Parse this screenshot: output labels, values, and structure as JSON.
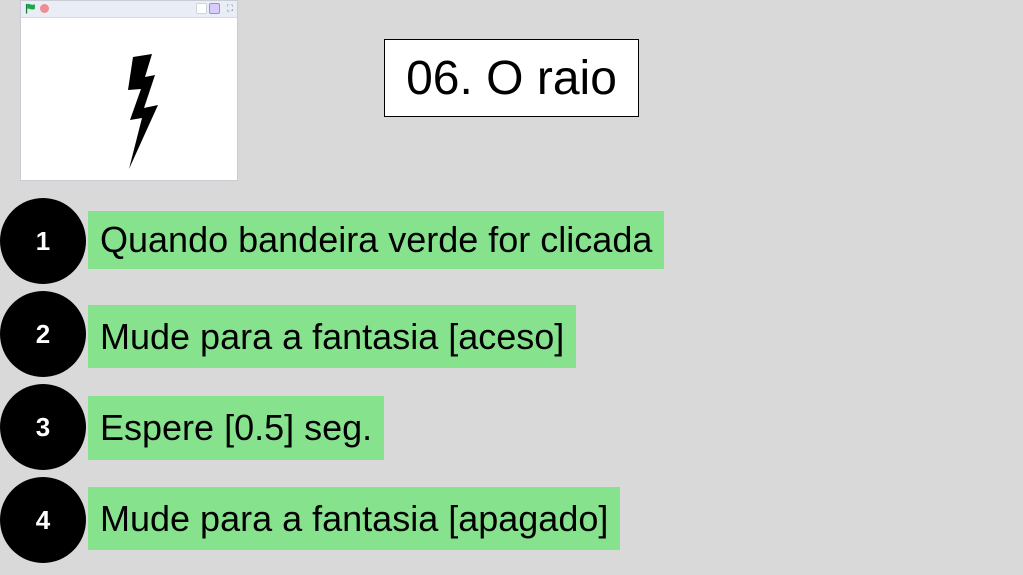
{
  "stage": {
    "toolbar": {
      "green_flag_icon": "green-flag-icon",
      "stop_icon": "stop-icon",
      "small_stage_icon": "small-stage-icon",
      "large_stage_icon": "large-stage-icon",
      "fullscreen_icon": "fullscreen-icon",
      "fullscreen_glyph": "⛶"
    },
    "sprite_icon": "lightning-bolt-icon"
  },
  "title": "06. O raio",
  "steps": [
    {
      "number": "1",
      "text": "Quando bandeira verde for clicada"
    },
    {
      "number": "2",
      "text": "Mude para a fantasia [aceso]"
    },
    {
      "number": "3",
      "text": "Espere [0.5] seg."
    },
    {
      "number": "4",
      "text": "Mude para a fantasia [apagado]"
    }
  ],
  "colors": {
    "background": "#d9d9d9",
    "step_highlight": "#87e28e",
    "step_circle": "#000000",
    "flag_green": "#1aa74b",
    "stop_red": "#f08c93"
  }
}
